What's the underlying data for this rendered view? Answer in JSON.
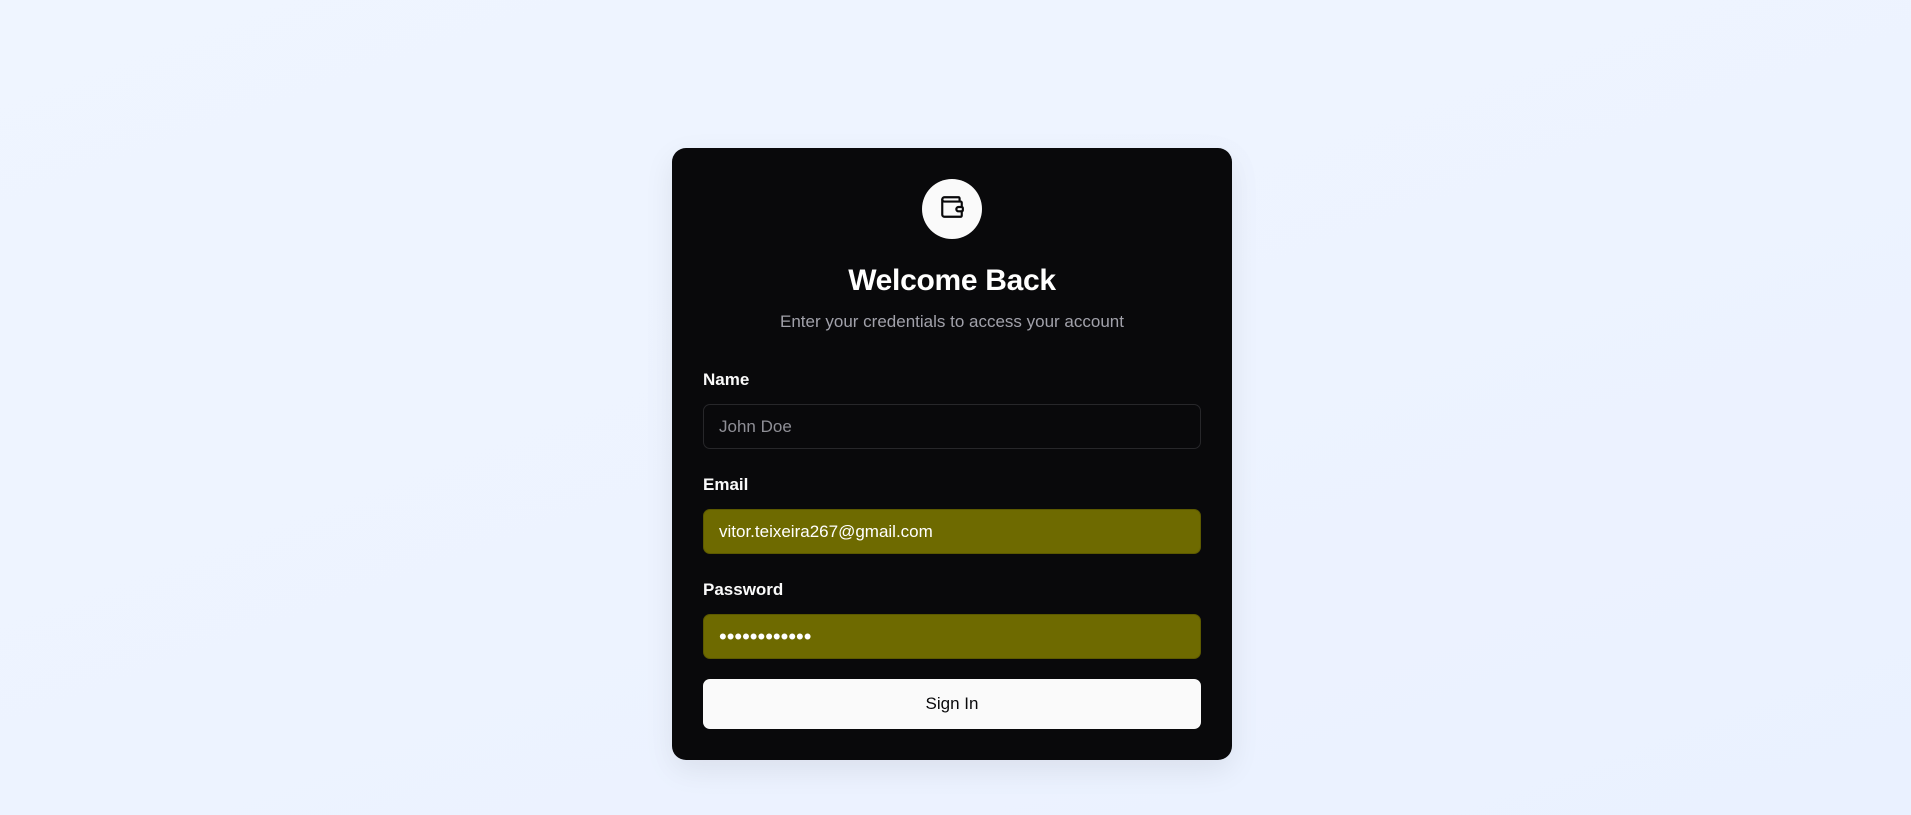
{
  "header": {
    "logo_icon": "wallet-icon",
    "title": "Welcome Back",
    "subtitle": "Enter your credentials to access your account"
  },
  "form": {
    "name": {
      "label": "Name",
      "placeholder": "John Doe",
      "value": ""
    },
    "email": {
      "label": "Email",
      "value": "vitor.teixeira267@gmail.com"
    },
    "password": {
      "label": "Password",
      "value": "••••••••••••"
    },
    "submit_label": "Sign In"
  },
  "colors": {
    "card_background": "#09090b",
    "autofill_background": "#6e6a00",
    "page_background": "#eef4ff",
    "button_background": "#fafafa"
  }
}
